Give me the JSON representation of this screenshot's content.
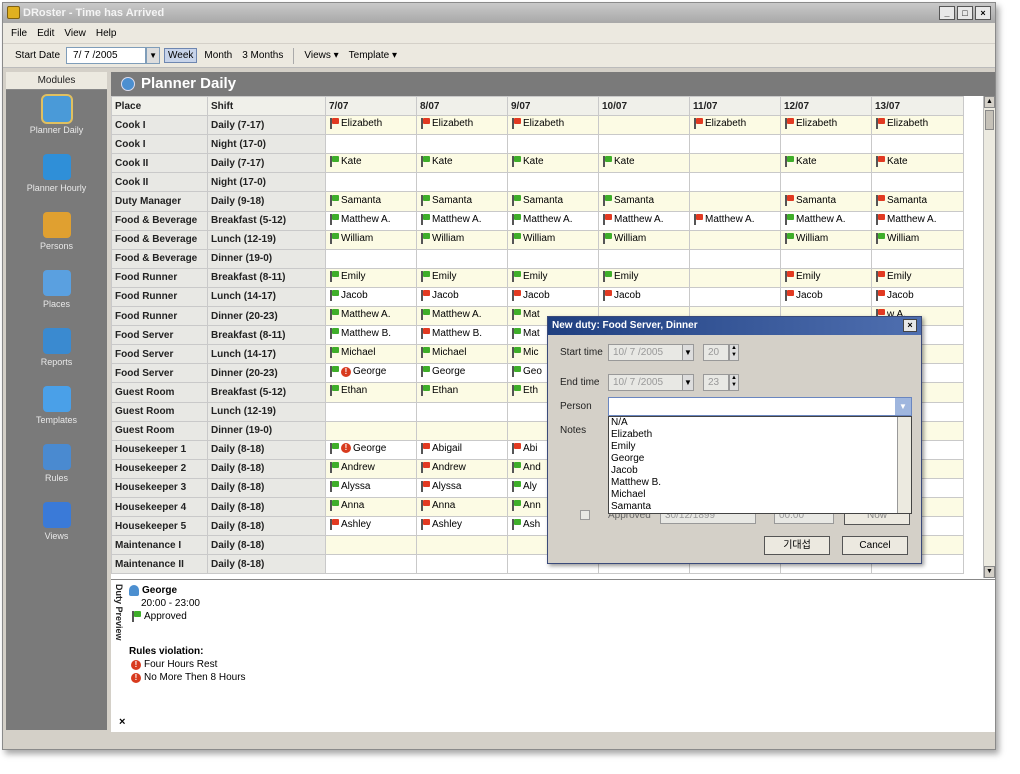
{
  "window": {
    "title": "DRoster - Time has Arrived",
    "controls": [
      "_",
      "□",
      "×"
    ]
  },
  "menu": [
    "File",
    "Edit",
    "View",
    "Help"
  ],
  "toolbar": {
    "start_label": "Start Date",
    "start_value": "7/ 7 /2005",
    "week": "Week",
    "month": "Month",
    "three_months": "3 Months",
    "views": "Views ▾",
    "template": "Template ▾"
  },
  "sidebar": {
    "header": "Modules",
    "items": [
      {
        "label": "Planner Daily",
        "icon": "planner-daily-icon",
        "color": "#4a9ad8"
      },
      {
        "label": "Planner Hourly",
        "icon": "planner-hourly-icon",
        "color": "#2f8fd8"
      },
      {
        "label": "Persons",
        "icon": "persons-icon",
        "color": "#e0a030"
      },
      {
        "label": "Places",
        "icon": "places-icon",
        "color": "#5aa0e0"
      },
      {
        "label": "Reports",
        "icon": "reports-icon",
        "color": "#3a8ad0"
      },
      {
        "label": "Templates",
        "icon": "templates-icon",
        "color": "#4aa0e8"
      },
      {
        "label": "Rules",
        "icon": "rules-icon",
        "color": "#4a8ad0"
      },
      {
        "label": "Views",
        "icon": "views-icon",
        "color": "#3a7ad8"
      }
    ]
  },
  "planner": {
    "title": "Planner Daily",
    "headers": [
      "Place",
      "Shift",
      "7/07",
      "8/07",
      "9/07",
      "10/07",
      "11/07",
      "12/07",
      "13/07"
    ],
    "rows": [
      {
        "place": "Cook I",
        "shift": "Daily (7-17)",
        "cells": [
          [
            "r",
            "Elizabeth"
          ],
          [
            "r",
            "Elizabeth"
          ],
          [
            "r",
            "Elizabeth"
          ],
          null,
          [
            "r",
            "Elizabeth"
          ],
          [
            "r",
            "Elizabeth"
          ],
          [
            "r",
            "Elizabeth"
          ]
        ]
      },
      {
        "place": "Cook I",
        "shift": "Night (17-0)",
        "cells": [
          null,
          null,
          null,
          null,
          null,
          null,
          null
        ]
      },
      {
        "place": "Cook II",
        "shift": "Daily (7-17)",
        "cells": [
          [
            "g",
            "Kate"
          ],
          [
            "g",
            "Kate"
          ],
          [
            "g",
            "Kate"
          ],
          [
            "g",
            "Kate"
          ],
          null,
          [
            "g",
            "Kate"
          ],
          [
            "r",
            "Kate"
          ]
        ]
      },
      {
        "place": "Cook II",
        "shift": "Night (17-0)",
        "cells": [
          null,
          null,
          null,
          null,
          null,
          null,
          null
        ]
      },
      {
        "place": "Duty Manager",
        "shift": "Daily (9-18)",
        "cells": [
          [
            "g",
            "Samanta"
          ],
          [
            "g",
            "Samanta"
          ],
          [
            "g",
            "Samanta"
          ],
          [
            "g",
            "Samanta"
          ],
          null,
          [
            "r",
            "Samanta"
          ],
          [
            "r",
            "Samanta"
          ]
        ]
      },
      {
        "place": "Food & Beverage",
        "shift": "Breakfast (5-12)",
        "cells": [
          [
            "g",
            "Matthew A."
          ],
          [
            "g",
            "Matthew A."
          ],
          [
            "g",
            "Matthew A."
          ],
          [
            "r",
            "Matthew A."
          ],
          [
            "r",
            "Matthew A."
          ],
          [
            "g",
            "Matthew A."
          ],
          [
            "r",
            "Matthew A."
          ]
        ]
      },
      {
        "place": "Food & Beverage",
        "shift": "Lunch (12-19)",
        "cells": [
          [
            "g",
            "William"
          ],
          [
            "g",
            "William"
          ],
          [
            "g",
            "William"
          ],
          [
            "g",
            "William"
          ],
          null,
          [
            "g",
            "William"
          ],
          [
            "g",
            "William"
          ]
        ]
      },
      {
        "place": "Food & Beverage",
        "shift": "Dinner (19-0)",
        "cells": [
          null,
          null,
          null,
          null,
          null,
          null,
          null
        ]
      },
      {
        "place": "Food Runner",
        "shift": "Breakfast (8-11)",
        "cells": [
          [
            "g",
            "Emily"
          ],
          [
            "g",
            "Emily"
          ],
          [
            "g",
            "Emily"
          ],
          [
            "g",
            "Emily"
          ],
          null,
          [
            "r",
            "Emily"
          ],
          [
            "r",
            "Emily"
          ]
        ]
      },
      {
        "place": "Food Runner",
        "shift": "Lunch (14-17)",
        "cells": [
          [
            "g",
            "Jacob"
          ],
          [
            "r",
            "Jacob"
          ],
          [
            "r",
            "Jacob"
          ],
          [
            "r",
            "Jacob"
          ],
          null,
          [
            "r",
            "Jacob"
          ],
          [
            "r",
            "Jacob"
          ]
        ]
      },
      {
        "place": "Food Runner",
        "shift": "Dinner (20-23)",
        "cells": [
          [
            "g",
            "Matthew A."
          ],
          [
            "g",
            "Matthew A."
          ],
          [
            "g",
            "Mat"
          ],
          null,
          null,
          null,
          [
            "r",
            "w A."
          ]
        ]
      },
      {
        "place": "Food Server",
        "shift": "Breakfast (8-11)",
        "cells": [
          [
            "g",
            "Matthew B."
          ],
          [
            "r",
            "Matthew B."
          ],
          [
            "g",
            "Mat"
          ],
          null,
          null,
          null,
          [
            "r",
            "w B."
          ]
        ]
      },
      {
        "place": "Food Server",
        "shift": "Lunch (14-17)",
        "cells": [
          [
            "g",
            "Michael"
          ],
          [
            "g",
            "Michael"
          ],
          [
            "g",
            "Mic"
          ],
          null,
          null,
          null,
          null
        ]
      },
      {
        "place": "Food Server",
        "shift": "Dinner (20-23)",
        "cells": [
          [
            "gw",
            "George"
          ],
          [
            "g",
            "George"
          ],
          [
            "g",
            "Geo"
          ],
          null,
          null,
          null,
          null
        ]
      },
      {
        "place": "Guest Room",
        "shift": "Breakfast (5-12)",
        "cells": [
          [
            "g",
            "Ethan"
          ],
          [
            "g",
            "Ethan"
          ],
          [
            "g",
            "Eth"
          ],
          null,
          null,
          null,
          null
        ]
      },
      {
        "place": "Guest Room",
        "shift": "Lunch (12-19)",
        "cells": [
          null,
          null,
          null,
          null,
          null,
          null,
          null
        ]
      },
      {
        "place": "Guest Room",
        "shift": "Dinner (19-0)",
        "cells": [
          null,
          null,
          null,
          null,
          null,
          null,
          null
        ]
      },
      {
        "place": "Housekeeper 1",
        "shift": "Daily (8-18)",
        "cells": [
          [
            "gw",
            "George"
          ],
          [
            "r",
            "Abigail"
          ],
          [
            "r",
            "Abi"
          ],
          null,
          null,
          null,
          null
        ]
      },
      {
        "place": "Housekeeper 2",
        "shift": "Daily (8-18)",
        "cells": [
          [
            "g",
            "Andrew"
          ],
          [
            "r",
            "Andrew"
          ],
          [
            "g",
            "And"
          ],
          null,
          null,
          null,
          [
            "g",
            "w"
          ]
        ]
      },
      {
        "place": "Housekeeper 3",
        "shift": "Daily (8-18)",
        "cells": [
          [
            "g",
            "Alyssa"
          ],
          [
            "r",
            "Alyssa"
          ],
          [
            "g",
            "Aly"
          ],
          null,
          null,
          null,
          null
        ]
      },
      {
        "place": "Housekeeper 4",
        "shift": "Daily (8-18)",
        "cells": [
          [
            "g",
            "Anna"
          ],
          [
            "r",
            "Anna"
          ],
          [
            "g",
            "Ann"
          ],
          null,
          null,
          null,
          null
        ]
      },
      {
        "place": "Housekeeper 5",
        "shift": "Daily (8-18)",
        "cells": [
          [
            "r",
            "Ashley"
          ],
          [
            "r",
            "Ashley"
          ],
          [
            "g",
            "Ash"
          ],
          null,
          null,
          null,
          null
        ]
      },
      {
        "place": "Maintenance I",
        "shift": "Daily (8-18)",
        "cells": [
          null,
          null,
          null,
          null,
          null,
          null,
          null
        ]
      },
      {
        "place": "Maintenance II",
        "shift": "Daily (8-18)",
        "cells": [
          null,
          null,
          null,
          null,
          null,
          null,
          null
        ]
      }
    ]
  },
  "preview": {
    "tab": "Duty Preview",
    "name": "George",
    "time": "20:00 - 23:00",
    "status": "Approved",
    "rules_title": "Rules violation:",
    "violations": [
      "Four Hours Rest",
      "No More Then 8 Hours"
    ],
    "close": "×"
  },
  "dialog": {
    "title": "New duty: Food Server, Dinner",
    "close": "×",
    "start_label": "Start time",
    "start_date": "10/ 7 /2005",
    "start_hour": "20",
    "end_label": "End time",
    "end_date": "10/ 7 /2005",
    "end_hour": "23",
    "person_label": "Person",
    "person_value": "",
    "notes_label": "Notes",
    "options": [
      "N/A",
      "Elizabeth",
      "Emily",
      "George",
      "Jacob",
      "Matthew B.",
      "Michael",
      "Samanta"
    ],
    "hidden_date": "30/12/1899",
    "hidden_time": "00:00",
    "hidden_btn": "Now",
    "hidden_text": "Approved",
    "ok": "기대섭",
    "cancel": "Cancel"
  },
  "colors": {
    "flag_green": "#3fae2a",
    "flag_red": "#e23a22",
    "alt_row": "#fcfbe4",
    "title_bar": "#7a7a7a"
  }
}
